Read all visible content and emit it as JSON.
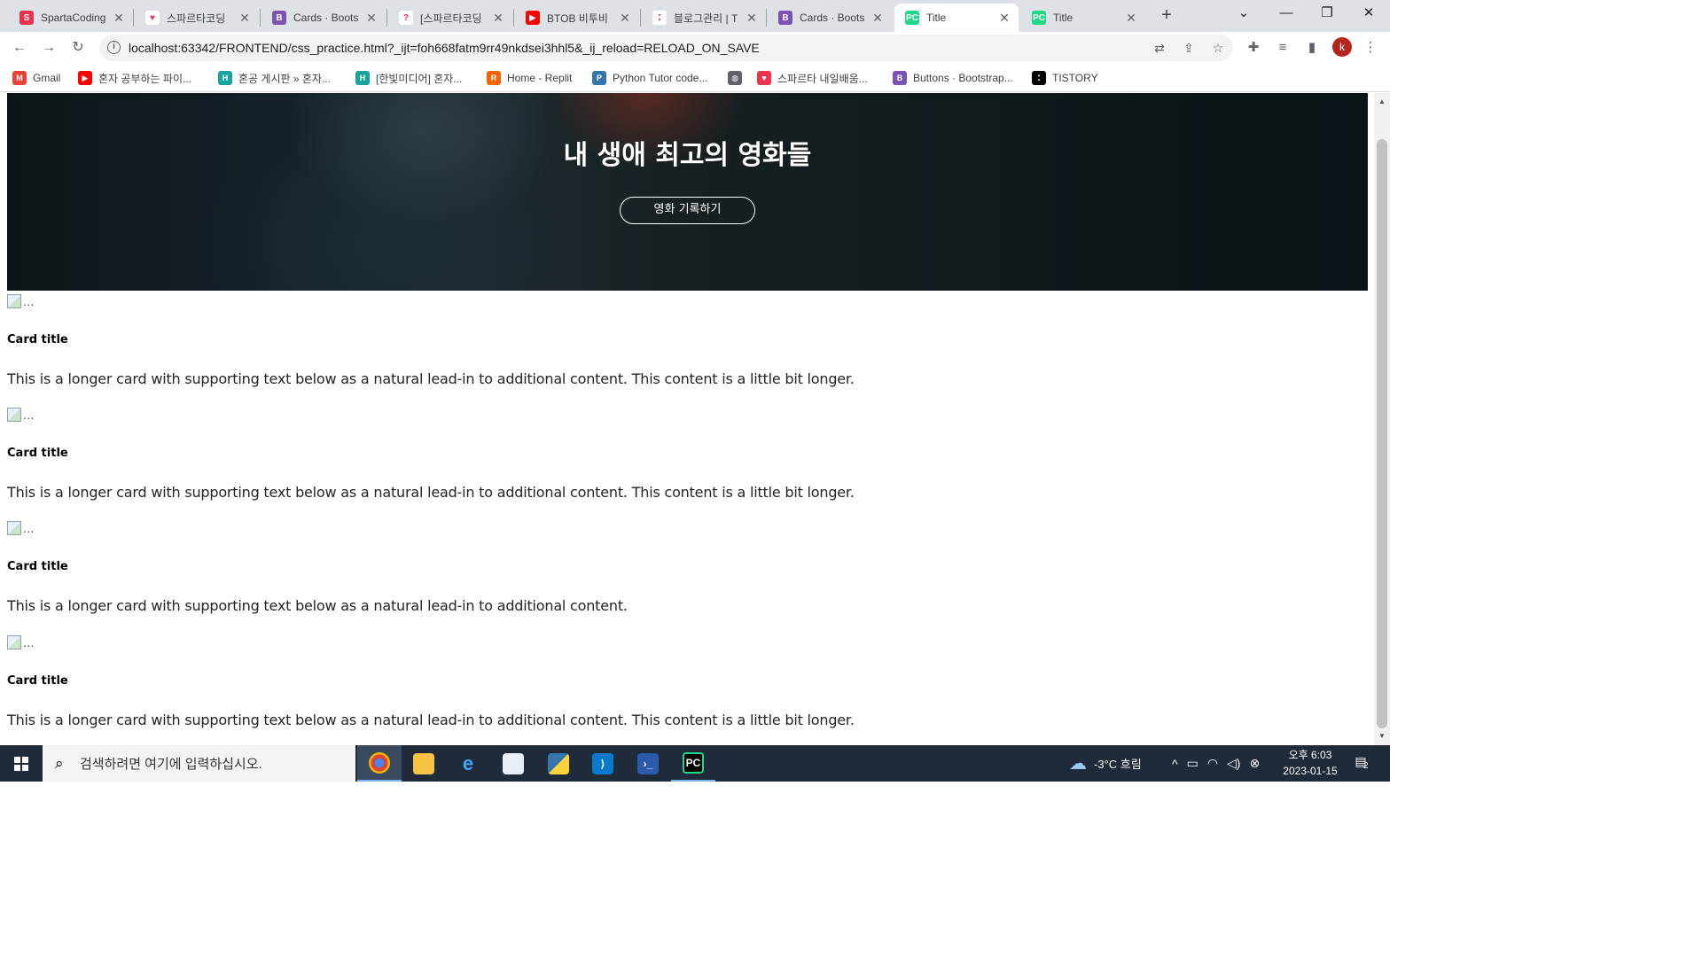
{
  "browser": {
    "tabs": [
      {
        "title": "SpartaCoding",
        "icon": "sparta-icon",
        "color": "#e8344e",
        "glyph": "S",
        "active": false
      },
      {
        "title": "스파르타코딩",
        "icon": "heart-icon",
        "color": "#ffffff",
        "glyph": "♥",
        "active": false
      },
      {
        "title": "Cards · Bootst",
        "icon": "bootstrap-icon",
        "color": "#7952b3",
        "glyph": "B",
        "active": false
      },
      {
        "title": "[스파르타코딩",
        "icon": "question-icon",
        "color": "#ffffff",
        "glyph": "?",
        "active": false
      },
      {
        "title": "BTOB 비투비",
        "icon": "youtube-icon",
        "color": "#ff0000",
        "glyph": "▶",
        "active": false
      },
      {
        "title": "블로그관리 | T",
        "icon": "tistory-icon",
        "color": "#ffffff",
        "glyph": "⁚",
        "active": false
      },
      {
        "title": "Cards · Boots",
        "icon": "bootstrap-icon",
        "color": "#7952b3",
        "glyph": "B",
        "active": false
      },
      {
        "title": "Title",
        "icon": "pycharm-icon",
        "color": "#21d789",
        "glyph": "PC",
        "active": true
      },
      {
        "title": "Title",
        "icon": "pycharm-icon",
        "color": "#21d789",
        "glyph": "PC",
        "active": false
      }
    ],
    "close_glyph": "✕",
    "new_tab_glyph": "+",
    "url": "localhost:63342/FRONTEND/css_practice.html?_ijt=foh668fatm9rr49nkdsei3hhl5&_ij_reload=RELOAD_ON_SAVE",
    "profile_initial": "k",
    "bookmarks": [
      {
        "label": "Gmail",
        "icon": "gmail-icon",
        "color": "#ea4335",
        "glyph": "M"
      },
      {
        "label": "혼자 공부하는 파이...",
        "icon": "youtube-icon",
        "color": "#ff0000",
        "glyph": "▶"
      },
      {
        "label": "혼공 게시판 » 혼자...",
        "icon": "hongong-icon",
        "color": "#1aa39b",
        "glyph": "H"
      },
      {
        "label": "[한빛미디어] 혼자...",
        "icon": "hanbit-icon",
        "color": "#1aa39b",
        "glyph": "H"
      },
      {
        "label": "Home - Replit",
        "icon": "replit-icon",
        "color": "#f26207",
        "glyph": "R"
      },
      {
        "label": "Python Tutor code...",
        "icon": "python-icon",
        "color": "#3776ab",
        "glyph": "P"
      },
      {
        "label": "",
        "icon": "globe-icon",
        "color": "#5f6368",
        "glyph": "◍"
      },
      {
        "label": "스파르타 내일배움...",
        "icon": "heart-icon",
        "color": "#e8344e",
        "glyph": "♥"
      },
      {
        "label": "Buttons · Bootstrap...",
        "icon": "bootstrap-icon",
        "color": "#7952b3",
        "glyph": "B"
      },
      {
        "label": "TISTORY",
        "icon": "tistory-icon",
        "color": "#000000",
        "glyph": "⁚"
      }
    ]
  },
  "page": {
    "hero_title": "내 생애 최고의 영화들",
    "hero_button": "영화 기록하기",
    "cards": [
      {
        "img_alt": "...",
        "title": "Card title",
        "text": "This is a longer card with supporting text below as a natural lead-in to additional content. This content is a little bit longer."
      },
      {
        "img_alt": "...",
        "title": "Card title",
        "text": "This is a longer card with supporting text below as a natural lead-in to additional content. This content is a little bit longer."
      },
      {
        "img_alt": "...",
        "title": "Card title",
        "text": "This is a longer card with supporting text below as a natural lead-in to additional content."
      },
      {
        "img_alt": "...",
        "title": "Card title",
        "text": "This is a longer card with supporting text below as a natural lead-in to additional content. This content is a little bit longer."
      }
    ]
  },
  "taskbar": {
    "search_placeholder": "검색하려면 여기에 입력하십시오.",
    "weather": "-3°C 흐림",
    "time": "오후 6:03",
    "date": "2023-01-15",
    "notification_count": "2"
  }
}
